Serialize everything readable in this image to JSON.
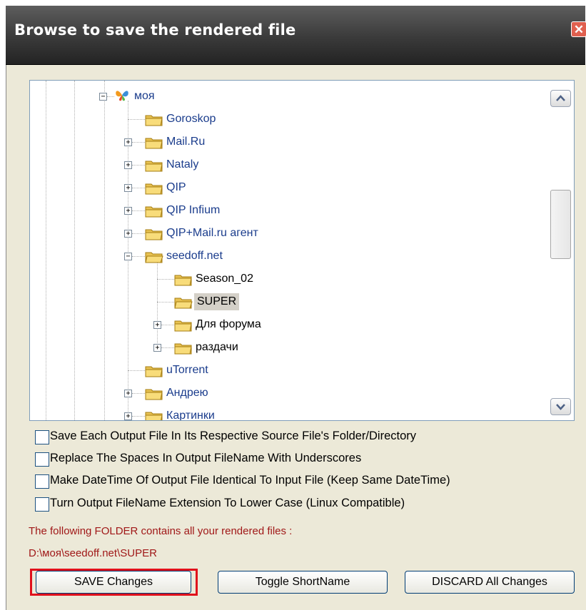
{
  "dialog": {
    "title": "Browse to save the rendered file",
    "close_glyph": "✕"
  },
  "tree": {
    "root": {
      "label": "моя",
      "icon": "butterfly-icon",
      "expander": "−"
    },
    "children": [
      {
        "label": "Goroskop",
        "expander": ""
      },
      {
        "label": "Mail.Ru",
        "expander": "+"
      },
      {
        "label": "Nataly",
        "expander": "+"
      },
      {
        "label": "QIP",
        "expander": "+"
      },
      {
        "label": "QIP Infium",
        "expander": "+"
      },
      {
        "label": "QIP+Mail.ru агент",
        "expander": "+"
      },
      {
        "label": "seedoff.net",
        "expander": "−"
      }
    ],
    "seedoff_children": [
      {
        "label": "Season_02",
        "expander": ""
      },
      {
        "label": "SUPER",
        "expander": "",
        "selected": true
      },
      {
        "label": "Для форума",
        "expander": "+"
      },
      {
        "label": "раздачи",
        "expander": "+"
      }
    ],
    "after": [
      {
        "label": "uTorrent",
        "expander": ""
      },
      {
        "label": "Андрею",
        "expander": "+"
      },
      {
        "label": "Картинки",
        "expander": "+"
      }
    ],
    "scroll_up_icon": "chevron-up-icon",
    "scroll_down_icon": "chevron-down-icon"
  },
  "options": [
    {
      "label": "Save Each Output File In Its Respective Source File's Folder/Directory",
      "checked": false
    },
    {
      "label": "Replace The Spaces In Output FileName With Underscores",
      "checked": false
    },
    {
      "label": "Make DateTime Of Output File Identical To Input File (Keep Same DateTime)",
      "checked": false
    },
    {
      "label": "Turn Output FileName Extension To Lower Case (Linux Compatible)",
      "checked": false
    }
  ],
  "info": {
    "folder_text": "The following FOLDER contains all your rendered files :",
    "folder_path": "D:\\моя\\seedoff.net\\SUPER"
  },
  "buttons": {
    "save": "SAVE Changes",
    "toggle": "Toggle ShortName",
    "discard": "DISCARD All Changes"
  },
  "colors": {
    "info_text": "#a01818",
    "highlight": "#e0101b",
    "titlebar": "#3a3a3a"
  }
}
